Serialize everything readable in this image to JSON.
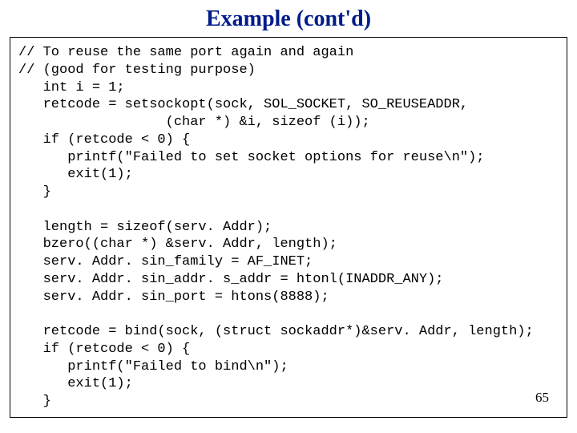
{
  "title": "Example (cont'd)",
  "page_number": "65",
  "code": {
    "l01": "// To reuse the same port again and again",
    "l02": "// (good for testing purpose)",
    "l03": "   int i = 1;",
    "l04": "   retcode = setsockopt(sock, SOL_SOCKET, SO_REUSEADDR,",
    "l05": "                  (char *) &i, sizeof (i));",
    "l06": "   if (retcode < 0) {",
    "l07": "      printf(\"Failed to set socket options for reuse\\n\");",
    "l08": "      exit(1);",
    "l09": "   }",
    "l10": "",
    "l11": "   length = sizeof(serv. Addr);",
    "l12": "   bzero((char *) &serv. Addr, length);",
    "l13": "   serv. Addr. sin_family = AF_INET;",
    "l14": "   serv. Addr. sin_addr. s_addr = htonl(INADDR_ANY);",
    "l15": "   serv. Addr. sin_port = htons(8888);",
    "l16": "",
    "l17": "   retcode = bind(sock, (struct sockaddr*)&serv. Addr, length);",
    "l18": "   if (retcode < 0) {",
    "l19": "      printf(\"Failed to bind\\n\");",
    "l20": "      exit(1);",
    "l21": "   }"
  }
}
